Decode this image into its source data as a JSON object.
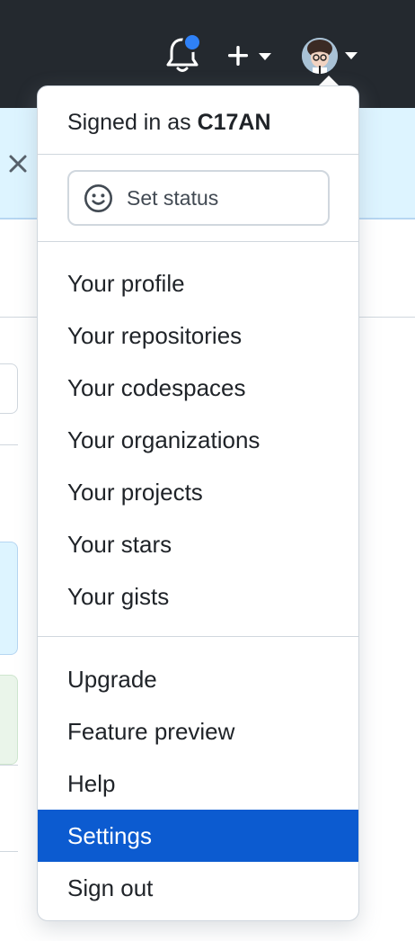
{
  "header": {
    "notifications_icon": "bell-icon",
    "notifications_dot_color": "#2f81f7",
    "create_icon": "plus-icon",
    "create_caret_icon": "caret-down-icon",
    "avatar_caret_icon": "caret-down-icon"
  },
  "dropdown": {
    "signed_in_prefix": "Signed in as",
    "username": "C17AN",
    "status_button_label": "Set status",
    "status_icon": "smiley-icon",
    "group_personal": [
      "Your profile",
      "Your repositories",
      "Your codespaces",
      "Your organizations",
      "Your projects",
      "Your stars",
      "Your gists"
    ],
    "group_account": [
      "Upgrade",
      "Feature preview",
      "Help",
      "Settings",
      "Sign out"
    ],
    "highlighted_item": "Settings",
    "highlight_color": "#0c5bd0"
  },
  "banner": {
    "close_icon": "close-icon"
  }
}
